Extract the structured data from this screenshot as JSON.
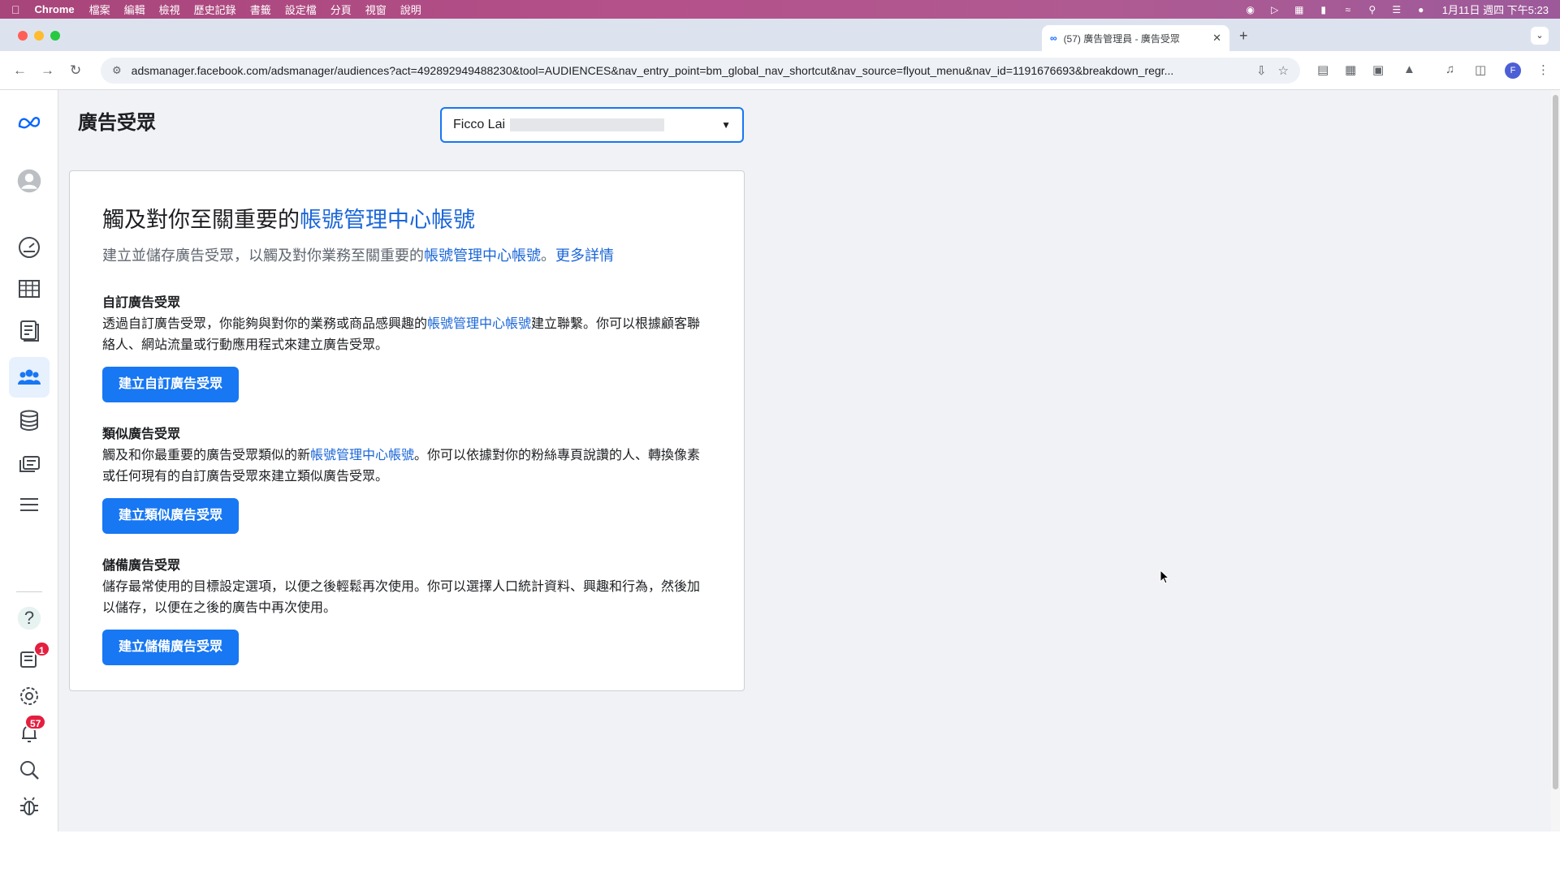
{
  "menubar": {
    "app": "Chrome",
    "items": [
      "檔案",
      "編輯",
      "檢視",
      "歷史記錄",
      "書籤",
      "設定檔",
      "分頁",
      "視窗",
      "說明"
    ],
    "clock": "1月11日 週四 下午5:23"
  },
  "browser": {
    "tab_title": "(57) 廣告管理員 - 廣告受眾",
    "url": "adsmanager.facebook.com/adsmanager/audiences?act=492892949488230&tool=AUDIENCES&nav_entry_point=bm_global_nav_shortcut&nav_source=flyout_menu&nav_id=1191676693&breakdown_regr...",
    "profile_initial": "F"
  },
  "sidebar": {
    "help_label": "?",
    "notifications_badge": "1",
    "alerts_badge": "57"
  },
  "header": {
    "title": "廣告受眾",
    "account_name": "Ficco Lai"
  },
  "card": {
    "title_prefix": "觸及對你至關重要的",
    "title_link": "帳號管理中心帳號",
    "sub_prefix": "建立並儲存廣告受眾，以觸及對你業務至關重要的",
    "sub_link": "帳號管理中心帳號",
    "sub_sep": "。",
    "sub_more": "更多詳情",
    "sections": [
      {
        "heading": "自訂廣告受眾",
        "body_prefix": "透過自訂廣告受眾，你能夠與對你的業務或商品感興趣的",
        "body_link": "帳號管理中心帳號",
        "body_suffix": "建立聯繫。你可以根據顧客聯絡人、網站流量或行動應用程式來建立廣告受眾。",
        "button": "建立自訂廣告受眾"
      },
      {
        "heading": "類似廣告受眾",
        "body_prefix": "觸及和你最重要的廣告受眾類似的新",
        "body_link": "帳號管理中心帳號",
        "body_suffix": "。你可以依據對你的粉絲專頁說讚的人、轉換像素或任何現有的自訂廣告受眾來建立類似廣告受眾。",
        "button": "建立類似廣告受眾"
      },
      {
        "heading": "儲備廣告受眾",
        "body": "儲存最常使用的目標設定選項，以便之後輕鬆再次使用。你可以選擇人口統計資料、興趣和行為，然後加以儲存，以便在之後的廣告中再次使用。",
        "button": "建立儲備廣告受眾"
      }
    ]
  },
  "colors": {
    "accent": "#1877f2",
    "link": "#1a66d8",
    "badge": "#e41e3f",
    "background": "#f0f2f5"
  }
}
